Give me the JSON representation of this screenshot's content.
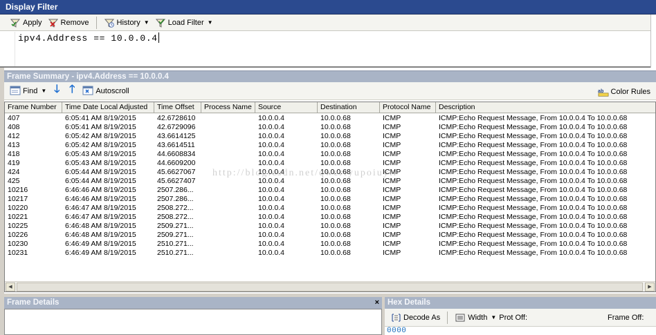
{
  "display_filter": {
    "title": "Display Filter",
    "toolbar": {
      "apply": "Apply",
      "remove": "Remove",
      "history": "History",
      "load_filter": "Load Filter"
    },
    "expression": "ipv4.Address == 10.0.0.4"
  },
  "frame_summary": {
    "title": "Frame Summary - ipv4.Address == 10.0.0.4",
    "toolbar": {
      "find": "Find",
      "autoscroll": "Autoscroll",
      "color_rules": "Color Rules"
    },
    "columns": [
      "Frame Number",
      "Time Date Local Adjusted",
      "Time Offset",
      "Process Name",
      "Source",
      "Destination",
      "Protocol Name",
      "Description"
    ],
    "rows": [
      [
        "407",
        "6:05:41 AM 8/19/2015",
        "42.6728610",
        "",
        "10.0.0.4",
        "10.0.0.68",
        "ICMP",
        "ICMP:Echo Request Message, From 10.0.0.4 To 10.0.0.68"
      ],
      [
        "408",
        "6:05:41 AM 8/19/2015",
        "42.6729096",
        "",
        "10.0.0.4",
        "10.0.0.68",
        "ICMP",
        "ICMP:Echo Request Message, From 10.0.0.4 To 10.0.0.68"
      ],
      [
        "412",
        "6:05:42 AM 8/19/2015",
        "43.6614125",
        "",
        "10.0.0.4",
        "10.0.0.68",
        "ICMP",
        "ICMP:Echo Request Message, From 10.0.0.4 To 10.0.0.68"
      ],
      [
        "413",
        "6:05:42 AM 8/19/2015",
        "43.6614511",
        "",
        "10.0.0.4",
        "10.0.0.68",
        "ICMP",
        "ICMP:Echo Request Message, From 10.0.0.4 To 10.0.0.68"
      ],
      [
        "418",
        "6:05:43 AM 8/19/2015",
        "44.6608834",
        "",
        "10.0.0.4",
        "10.0.0.68",
        "ICMP",
        "ICMP:Echo Request Message, From 10.0.0.4 To 10.0.0.68"
      ],
      [
        "419",
        "6:05:43 AM 8/19/2015",
        "44.6609200",
        "",
        "10.0.0.4",
        "10.0.0.68",
        "ICMP",
        "ICMP:Echo Request Message, From 10.0.0.4 To 10.0.0.68"
      ],
      [
        "424",
        "6:05:44 AM 8/19/2015",
        "45.6627067",
        "",
        "10.0.0.4",
        "10.0.0.68",
        "ICMP",
        "ICMP:Echo Request Message, From 10.0.0.4 To 10.0.0.68"
      ],
      [
        "425",
        "6:05:44 AM 8/19/2015",
        "45.6627407",
        "",
        "10.0.0.4",
        "10.0.0.68",
        "ICMP",
        "ICMP:Echo Request Message, From 10.0.0.4 To 10.0.0.68"
      ],
      [
        "10216",
        "6:46:46 AM 8/19/2015",
        "2507.286...",
        "",
        "10.0.0.4",
        "10.0.0.68",
        "ICMP",
        "ICMP:Echo Request Message, From 10.0.0.4 To 10.0.0.68"
      ],
      [
        "10217",
        "6:46:46 AM 8/19/2015",
        "2507.286...",
        "",
        "10.0.0.4",
        "10.0.0.68",
        "ICMP",
        "ICMP:Echo Request Message, From 10.0.0.4 To 10.0.0.68"
      ],
      [
        "10220",
        "6:46:47 AM 8/19/2015",
        "2508.272...",
        "",
        "10.0.0.4",
        "10.0.0.68",
        "ICMP",
        "ICMP:Echo Request Message, From 10.0.0.4 To 10.0.0.68"
      ],
      [
        "10221",
        "6:46:47 AM 8/19/2015",
        "2508.272...",
        "",
        "10.0.0.4",
        "10.0.0.68",
        "ICMP",
        "ICMP:Echo Request Message, From 10.0.0.4 To 10.0.0.68"
      ],
      [
        "10225",
        "6:46:48 AM 8/19/2015",
        "2509.271...",
        "",
        "10.0.0.4",
        "10.0.0.68",
        "ICMP",
        "ICMP:Echo Request Message, From 10.0.0.4 To 10.0.0.68"
      ],
      [
        "10226",
        "6:46:48 AM 8/19/2015",
        "2509.271...",
        "",
        "10.0.0.4",
        "10.0.0.68",
        "ICMP",
        "ICMP:Echo Request Message, From 10.0.0.4 To 10.0.0.68"
      ],
      [
        "10230",
        "6:46:49 AM 8/19/2015",
        "2510.271...",
        "",
        "10.0.0.4",
        "10.0.0.68",
        "ICMP",
        "ICMP:Echo Request Message, From 10.0.0.4 To 10.0.0.68"
      ],
      [
        "10231",
        "6:46:49 AM 8/19/2015",
        "2510.271...",
        "",
        "10.0.0.4",
        "10.0.0.68",
        "ICMP",
        "ICMP:Echo Request Message, From 10.0.0.4 To 10.0.0.68"
      ]
    ],
    "watermark": "http://blog.csdn.net/qwertyupoiuytr"
  },
  "frame_details": {
    "title": "Frame Details",
    "close": "×"
  },
  "hex_details": {
    "title": "Hex Details",
    "toolbar": {
      "decode_as": "Decode As",
      "width": "Width",
      "prot_off": "Prot Off:",
      "frame_off": "Frame Off:"
    },
    "offset": "0000"
  },
  "colors": {
    "title_bar": "#2b4a8f",
    "pane_header": "#a9b4c6",
    "hex_offset": "#1a6fbf",
    "arrow_blue": "#1f6fd1"
  },
  "icons": [
    "apply-icon",
    "remove-icon",
    "history-icon",
    "load-filter-icon",
    "find-icon",
    "scroll-down-icon",
    "scroll-up-icon",
    "autoscroll-icon",
    "color-rules-icon",
    "decode-as-icon",
    "width-icon"
  ]
}
